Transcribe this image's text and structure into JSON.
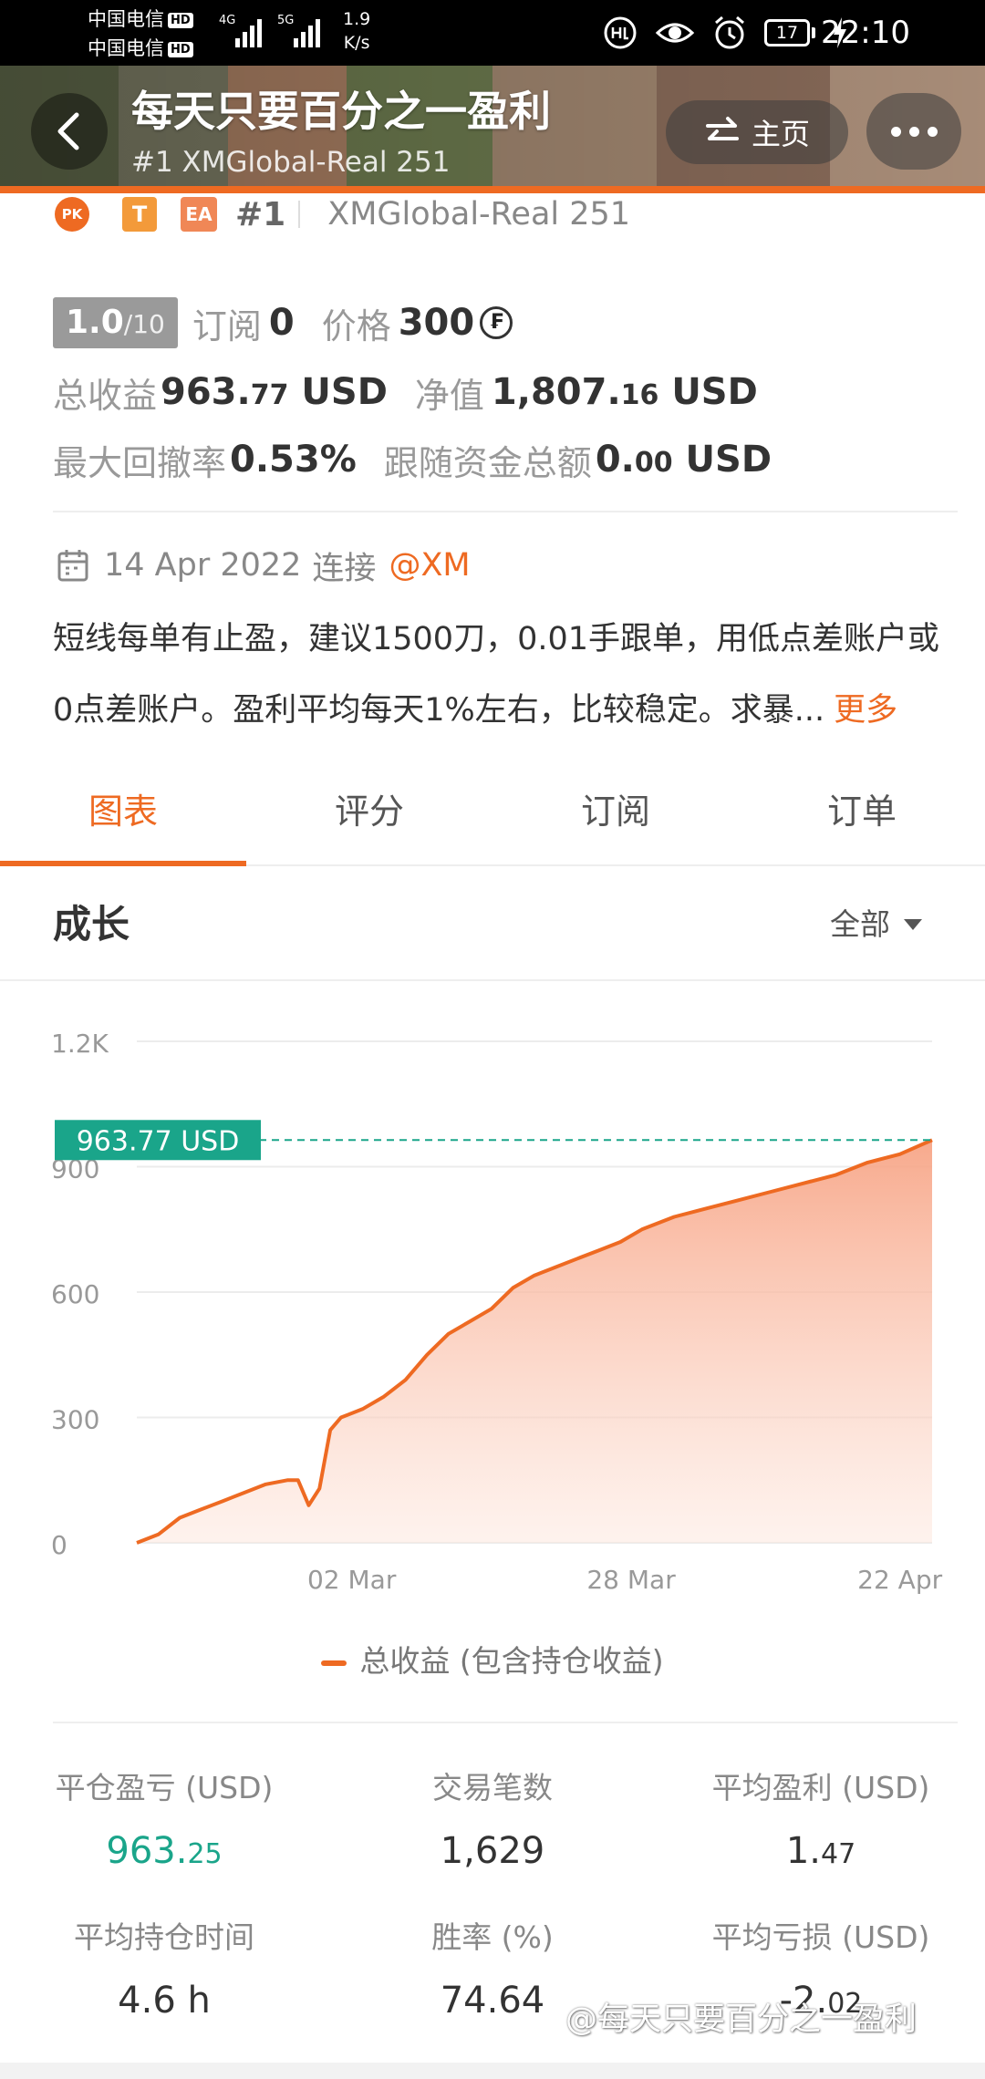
{
  "status_bar": {
    "carrier1": "中国电信",
    "carrier2": "中国电信",
    "hd_badge": "HD",
    "net1": "4G",
    "net2": "5G",
    "speed_value": "1.9",
    "speed_unit": "K/s",
    "battery": "17",
    "time": "22:10"
  },
  "header": {
    "title": "每天只要百分之一盈利",
    "subtitle": "#1  XMGlobal-Real 251",
    "home_label": "主页",
    "accent": "#ee6a22"
  },
  "profile": {
    "badge_pk": "PK",
    "badge_t": "T",
    "badge_ea": "EA",
    "rank": "#1",
    "account": "XMGlobal-Real 251",
    "score": "1.0",
    "score_max": "/10",
    "subscribe_label": "订阅",
    "subscribe_count": "0",
    "price_label": "价格",
    "price_value": "300",
    "price_icon": "₣",
    "total_profit_label": "总收益",
    "total_profit_main": "963.",
    "total_profit_dec": "77",
    "total_profit_unit": "USD",
    "equity_label": "净值",
    "equity_main": "1,807.",
    "equity_dec": "16",
    "equity_unit": "USD",
    "drawdown_label": "最大回撤率",
    "drawdown_value": "0.53%",
    "follow_label": "跟随资金总额",
    "follow_main": "0.",
    "follow_dec": "00",
    "follow_unit": "USD",
    "connect_date": "14 Apr 2022",
    "connect_label": "连接",
    "broker": "@XM",
    "description_line1": "短线每单有止盈，建议1500刀，0.01手跟单，用低点差账户或",
    "description_line2": "0点差账户。盈利平均每天1%左右，比较稳定。求暴...",
    "more_label": "更多"
  },
  "tabs": [
    {
      "label": "图表",
      "active": true
    },
    {
      "label": "评分",
      "active": false
    },
    {
      "label": "订阅",
      "active": false
    },
    {
      "label": "订单",
      "active": false
    }
  ],
  "section": {
    "title": "成长",
    "filter": "全部"
  },
  "chart_data": {
    "type": "area",
    "title": "",
    "ylabel": "",
    "xlabel": "",
    "ylim": [
      0,
      1200
    ],
    "yticks": [
      "0",
      "300",
      "600",
      "900",
      "1.2K"
    ],
    "ytick_values": [
      0,
      300,
      600,
      900,
      1200
    ],
    "xticks": [
      "02 Mar",
      "28 Mar",
      "22 Apr"
    ],
    "xlim": [
      "2022-02-10",
      "2022-04-25"
    ],
    "current_value_label": "963.77 USD",
    "series": [
      {
        "name": "总收益 (包含持仓收益)",
        "color": "#ee6a22",
        "x": [
          "2022-02-10",
          "2022-02-12",
          "2022-02-14",
          "2022-02-16",
          "2022-02-18",
          "2022-02-20",
          "2022-02-22",
          "2022-02-24",
          "2022-02-25",
          "2022-02-26",
          "2022-02-27",
          "2022-02-28",
          "2022-03-01",
          "2022-03-03",
          "2022-03-05",
          "2022-03-07",
          "2022-03-09",
          "2022-03-11",
          "2022-03-13",
          "2022-03-15",
          "2022-03-17",
          "2022-03-19",
          "2022-03-21",
          "2022-03-23",
          "2022-03-25",
          "2022-03-27",
          "2022-03-29",
          "2022-04-01",
          "2022-04-04",
          "2022-04-07",
          "2022-04-10",
          "2022-04-13",
          "2022-04-16",
          "2022-04-19",
          "2022-04-22",
          "2022-04-25"
        ],
        "values": [
          0,
          20,
          60,
          80,
          100,
          120,
          140,
          150,
          150,
          90,
          130,
          270,
          300,
          320,
          350,
          390,
          450,
          500,
          530,
          560,
          610,
          640,
          660,
          680,
          700,
          720,
          750,
          780,
          800,
          820,
          840,
          860,
          880,
          910,
          930,
          963.77
        ]
      }
    ]
  },
  "legend_label": "总收益 (包含持仓收益)",
  "metrics": [
    {
      "label": "平仓盈亏 (USD)",
      "main": "963.",
      "dec": "25",
      "green": true
    },
    {
      "label": "交易笔数",
      "main": "1,629",
      "dec": "",
      "green": false
    },
    {
      "label": "平均盈利 (USD)",
      "main": "1.",
      "dec": "47",
      "green": false
    },
    {
      "label": "平均持仓时间",
      "main": "4.6 h",
      "dec": "",
      "green": false
    },
    {
      "label": "胜率 (%)",
      "main": "74.64",
      "dec": "",
      "green": false
    },
    {
      "label": "平均亏损 (USD)",
      "main": "-2.",
      "dec": "02",
      "green": false
    }
  ],
  "watermark": "@每天只要百分之一盈利"
}
